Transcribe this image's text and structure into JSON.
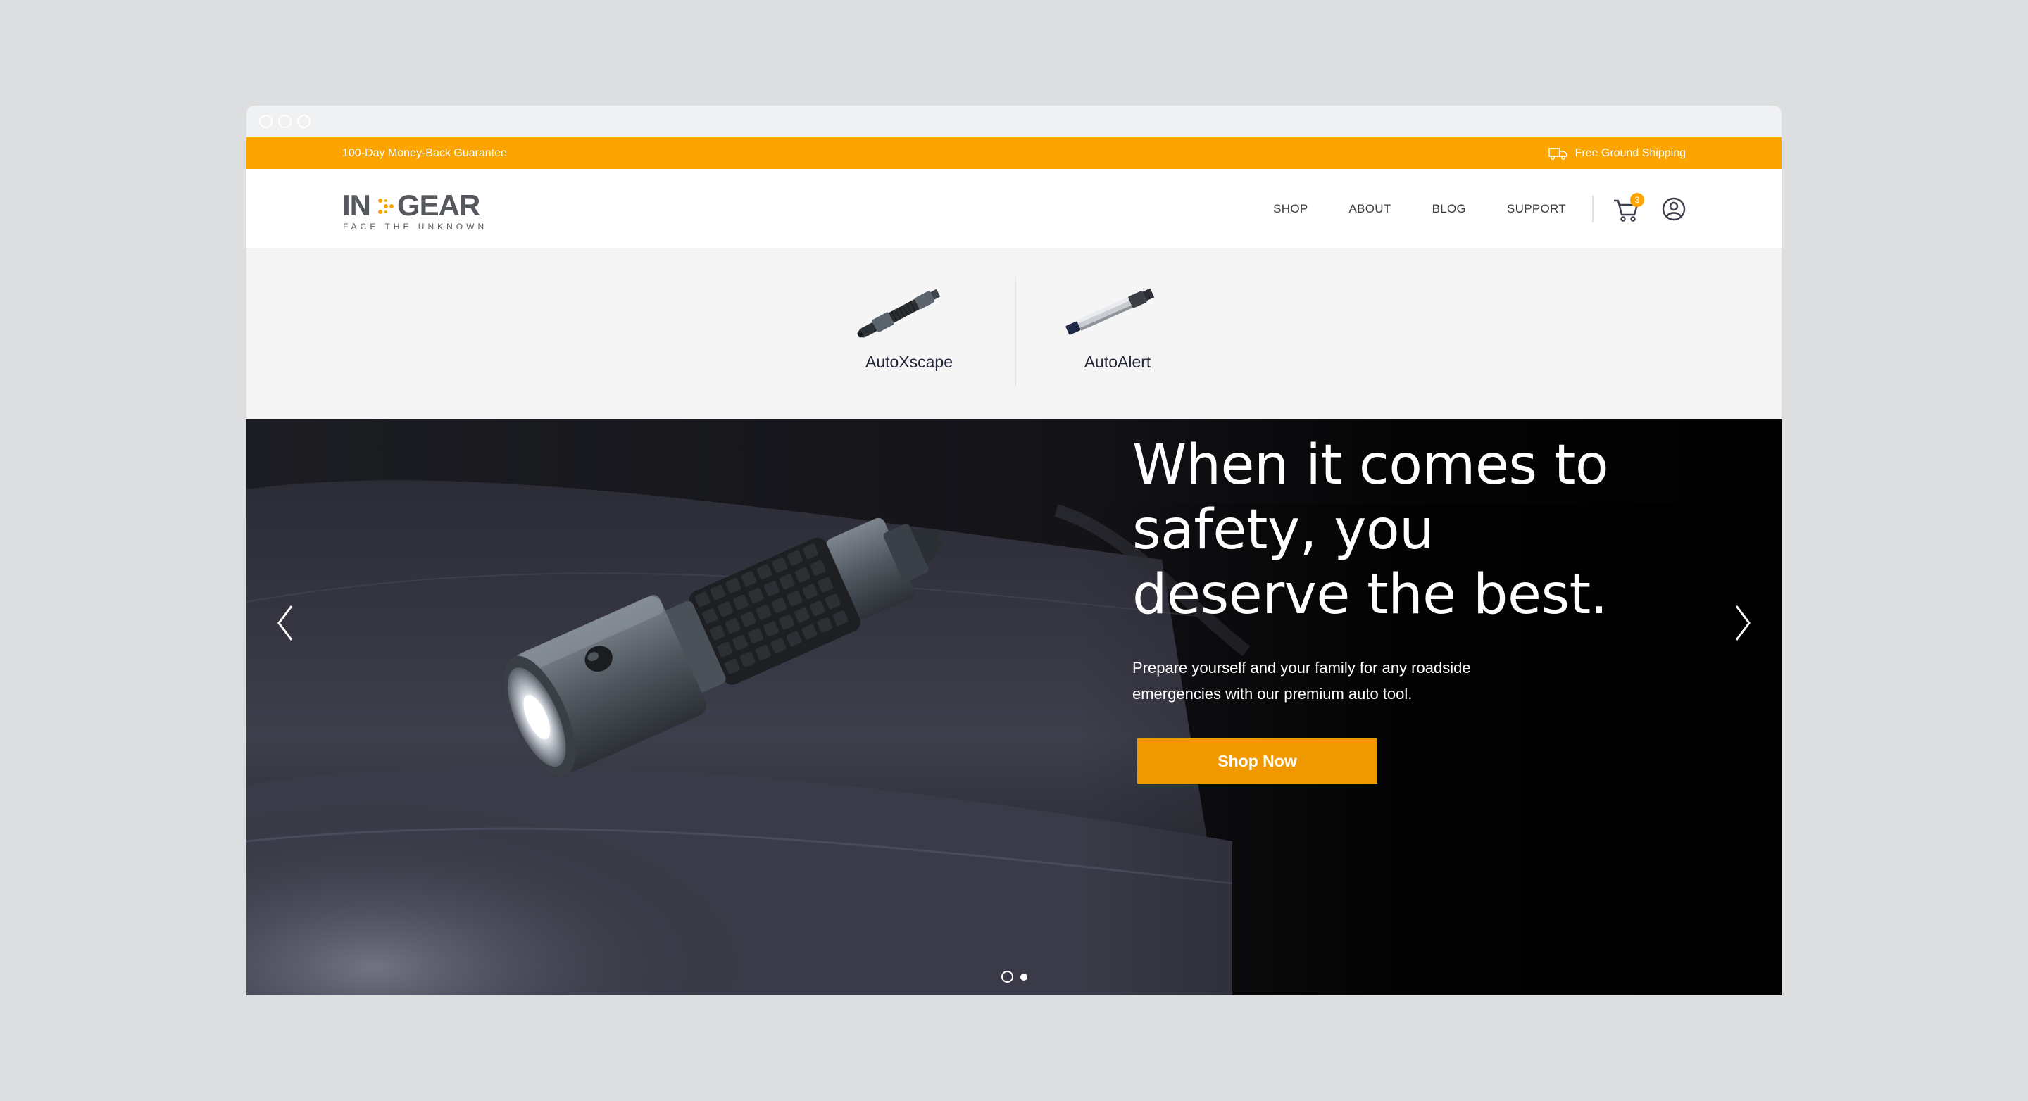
{
  "promo": {
    "left_text": "100-Day Money-Back Guarantee",
    "right_text": "Free Ground Shipping",
    "right_icon": "truck-icon"
  },
  "logo": {
    "word_left": "IN",
    "word_right": "GEAR",
    "tagline": "FACE THE UNKNOWN"
  },
  "nav": {
    "items": [
      "SHOP",
      "ABOUT",
      "BLOG",
      "SUPPORT"
    ],
    "cart_count": "3",
    "cart_icon": "cart-icon",
    "user_icon": "user-icon"
  },
  "products": [
    {
      "name": "AutoXscape"
    },
    {
      "name": "AutoAlert"
    }
  ],
  "hero": {
    "headline": "When it comes to safety, you deserve the best.",
    "subtext": "Prepare yourself and your family for any roadside emergencies with our premium auto tool.",
    "cta": "Shop Now",
    "slides": 2,
    "active_slide": 1
  },
  "colors": {
    "accent": "#fca400",
    "cta": "#f09800",
    "hero_bg": "#000000"
  }
}
